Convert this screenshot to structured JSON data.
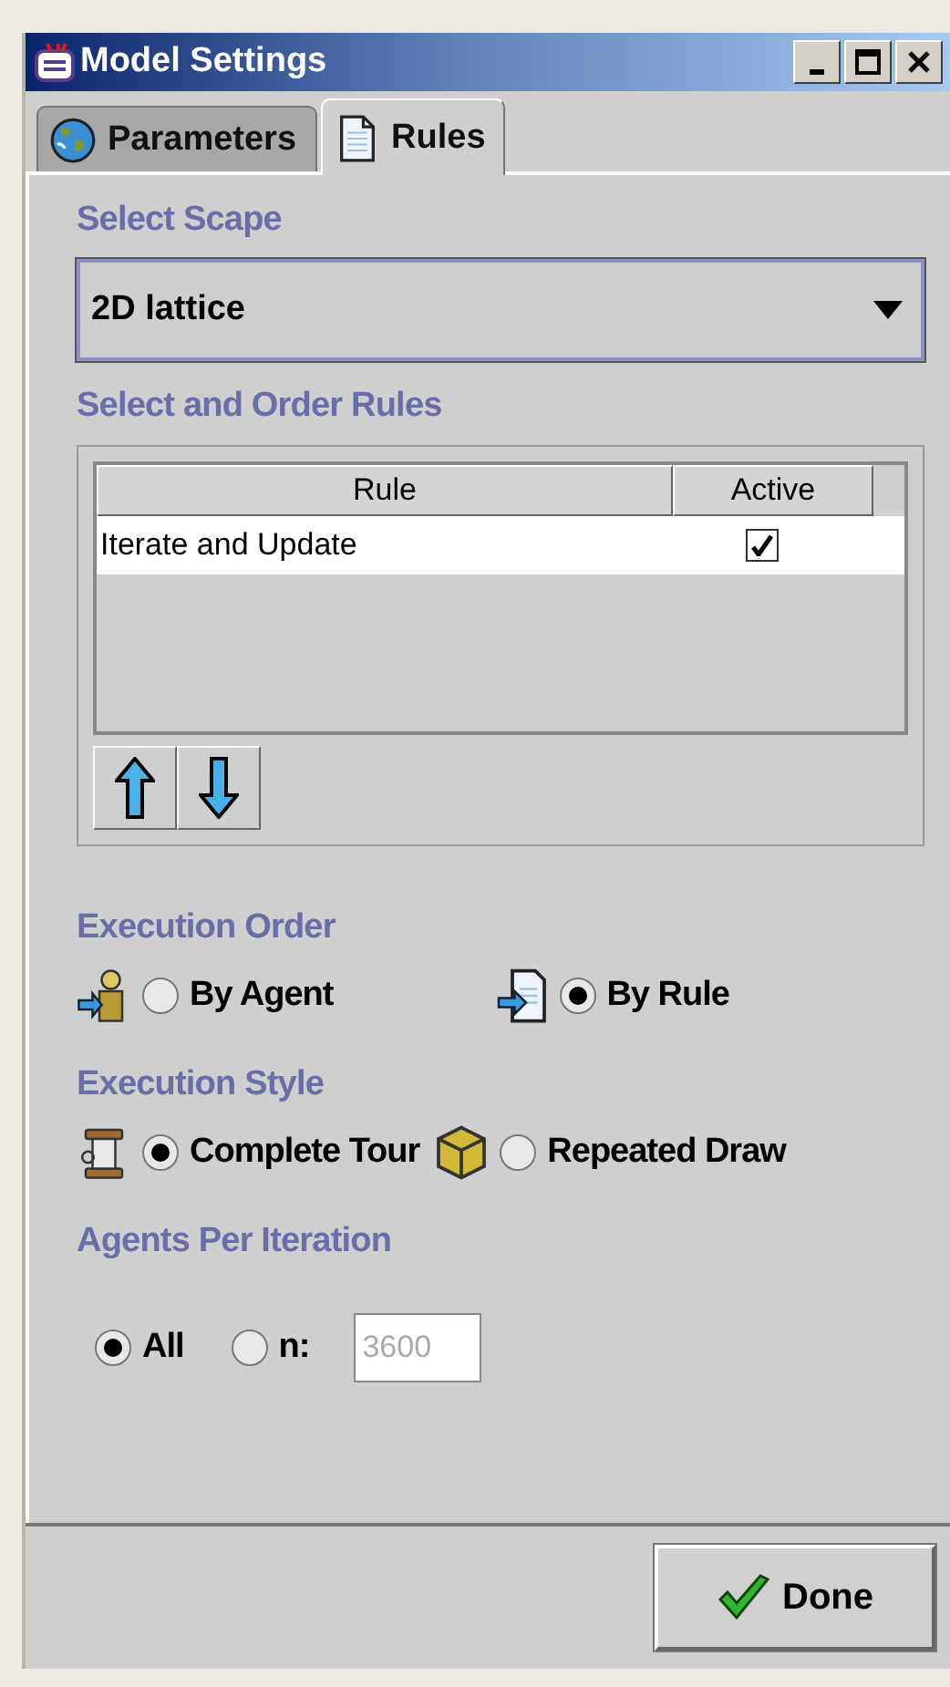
{
  "window": {
    "title": "Model Settings"
  },
  "tabs": [
    {
      "label": "Parameters",
      "selected": false
    },
    {
      "label": "Rules",
      "selected": true
    }
  ],
  "scape": {
    "heading": "Select Scape",
    "value": "2D lattice"
  },
  "rules": {
    "heading": "Select and Order Rules",
    "columns": [
      "Rule",
      "Active"
    ],
    "rows": [
      {
        "rule": "Iterate and Update",
        "active": true,
        "selected": true
      }
    ]
  },
  "execution_order": {
    "heading": "Execution Order",
    "options": [
      {
        "label": "By Agent",
        "selected": false
      },
      {
        "label": "By Rule",
        "selected": true
      }
    ]
  },
  "execution_style": {
    "heading": "Execution Style",
    "options": [
      {
        "label": "Complete Tour",
        "selected": true
      },
      {
        "label": "Repeated Draw",
        "selected": false
      }
    ]
  },
  "agents_per_iteration": {
    "heading": "Agents Per Iteration",
    "options": [
      {
        "label": "All",
        "selected": true
      },
      {
        "label": "n:",
        "selected": false
      }
    ],
    "n_field": {
      "value": "3600",
      "disabled": true
    }
  },
  "done_button": {
    "label": "Done"
  }
}
